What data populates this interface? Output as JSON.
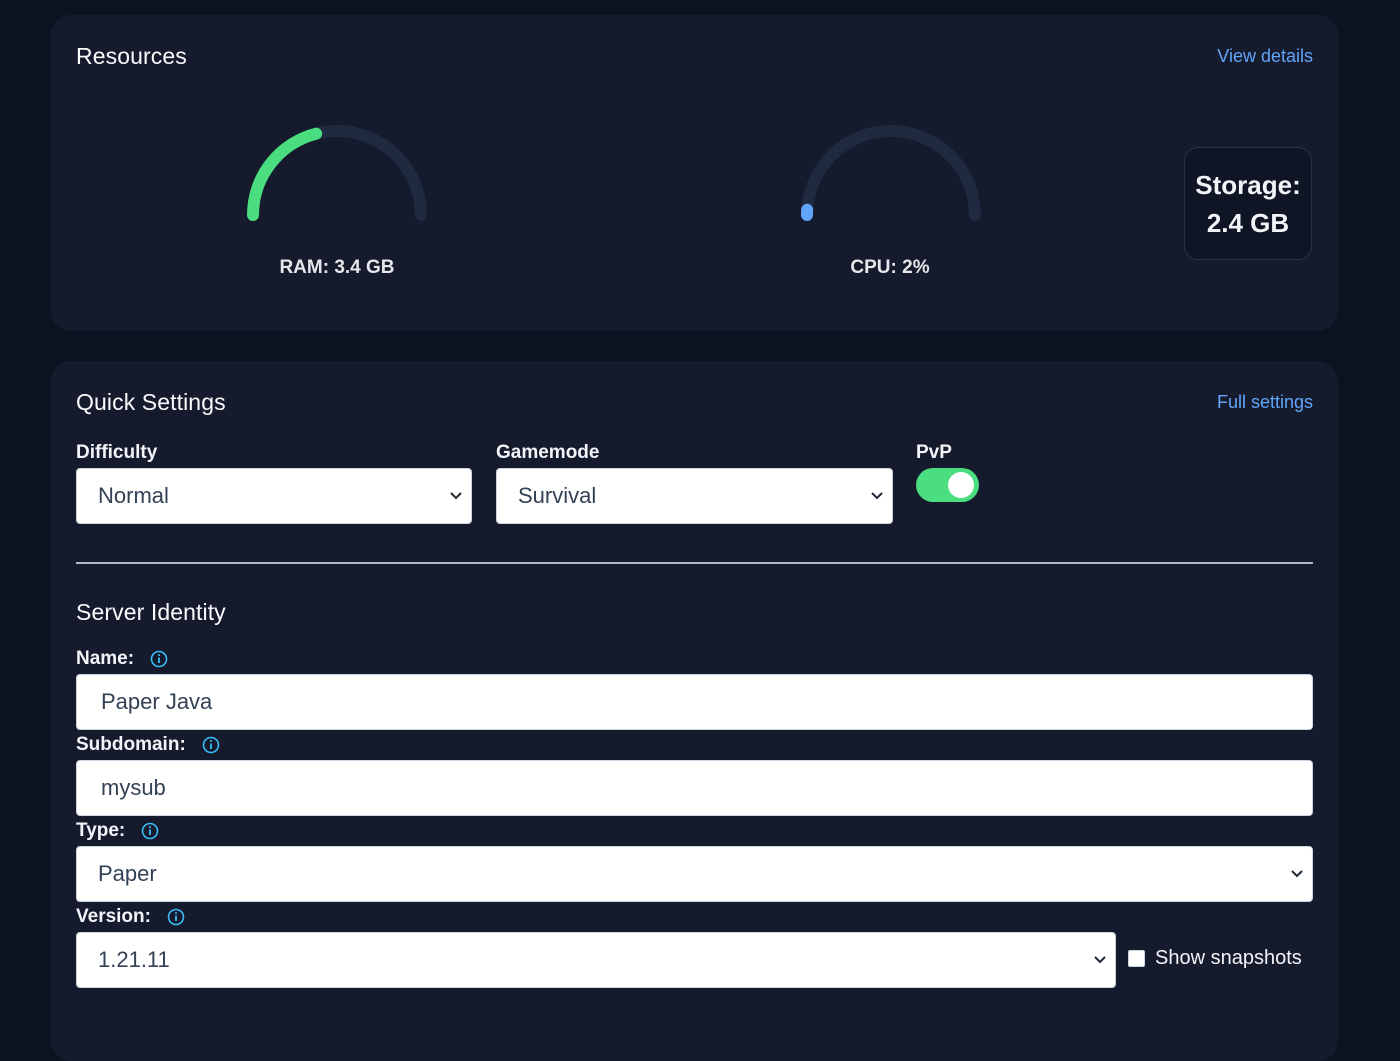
{
  "resources": {
    "title": "Resources",
    "link": "View details",
    "ram": {
      "label": "RAM: 3.4 GB",
      "fraction": 0.42,
      "color": "#4ade80"
    },
    "cpu": {
      "label": "CPU: 2%",
      "fraction": 0.02,
      "color": "#60a5fa"
    },
    "storage": {
      "label": "Storage:",
      "value": "2.4 GB"
    }
  },
  "quick_settings": {
    "title": "Quick Settings",
    "link": "Full settings",
    "difficulty": {
      "label": "Difficulty",
      "value": "Normal"
    },
    "gamemode": {
      "label": "Gamemode",
      "value": "Survival"
    },
    "pvp": {
      "label": "PvP",
      "enabled": true
    }
  },
  "server_identity": {
    "title": "Server Identity",
    "name": {
      "label": "Name:",
      "value": "Paper Java"
    },
    "subdomain": {
      "label": "Subdomain:",
      "value": "mysub"
    },
    "type": {
      "label": "Type:",
      "value": "Paper"
    },
    "version": {
      "label": "Version:",
      "value": "1.21.11"
    },
    "show_snapshots": {
      "label": "Show snapshots",
      "checked": false
    }
  },
  "icons": {
    "info": "info-circle-icon",
    "chevron": "chevron-down-icon"
  },
  "colors": {
    "accent_link": "#60a5fa",
    "success": "#4ade80",
    "info_icon": "#38bdf8",
    "card_bg": "#151b2d",
    "page_bg": "#0c1220"
  }
}
